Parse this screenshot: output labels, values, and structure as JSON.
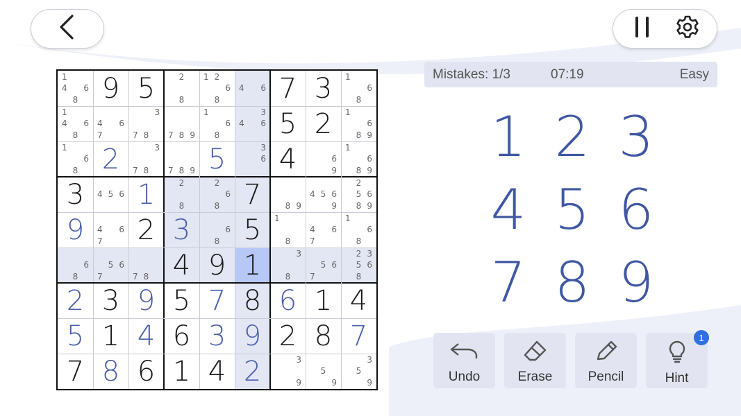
{
  "status": {
    "mistakes": "Mistakes: 1/3",
    "timer": "07:19",
    "difficulty": "Easy"
  },
  "number_pad": [
    "1",
    "2",
    "3",
    "4",
    "5",
    "6",
    "7",
    "8",
    "9"
  ],
  "tools": {
    "undo": "Undo",
    "erase": "Erase",
    "pencil": "Pencil",
    "hint": "Hint",
    "hint_count": "1"
  },
  "colors": {
    "accent": "#4058a3",
    "highlight": "#e3e6f3",
    "selected": "#b7c8f7"
  },
  "selected_cell": {
    "row": 5,
    "col": 5
  },
  "grid": [
    [
      {
        "n": [
          1,
          4,
          6,
          8
        ]
      },
      {
        "v": "9",
        "t": "g"
      },
      {
        "v": "5",
        "t": "g"
      },
      {
        "n": [
          2,
          8
        ]
      },
      {
        "n": [
          1,
          2,
          6,
          8
        ]
      },
      {
        "n": [
          4,
          6
        ]
      },
      {
        "v": "7",
        "t": "g"
      },
      {
        "v": "3",
        "t": "g"
      },
      {
        "n": [
          1,
          6,
          8
        ]
      }
    ],
    [
      {
        "n": [
          1,
          4,
          6,
          8
        ]
      },
      {
        "n": [
          4,
          6,
          7
        ]
      },
      {
        "n": [
          3,
          7,
          8
        ]
      },
      {
        "n": [
          7,
          8,
          9
        ]
      },
      {
        "n": [
          1,
          6,
          8
        ]
      },
      {
        "n": [
          3,
          4,
          6
        ]
      },
      {
        "v": "5",
        "t": "g"
      },
      {
        "v": "2",
        "t": "g"
      },
      {
        "n": [
          1,
          6,
          8,
          9
        ]
      }
    ],
    [
      {
        "n": [
          1,
          6,
          8
        ]
      },
      {
        "v": "2",
        "t": "u"
      },
      {
        "n": [
          3,
          7,
          8
        ]
      },
      {
        "n": [
          7,
          8,
          9
        ]
      },
      {
        "v": "5",
        "t": "u"
      },
      {
        "n": [
          3,
          6
        ]
      },
      {
        "v": "4",
        "t": "g"
      },
      {
        "n": [
          6,
          9
        ]
      },
      {
        "n": [
          1,
          6,
          8,
          9
        ]
      }
    ],
    [
      {
        "v": "3",
        "t": "g"
      },
      {
        "n": [
          4,
          5,
          6
        ]
      },
      {
        "v": "1",
        "t": "u"
      },
      {
        "n": [
          2,
          8
        ]
      },
      {
        "n": [
          2,
          6,
          8
        ]
      },
      {
        "v": "7",
        "t": "g"
      },
      {
        "n": [
          8,
          9
        ]
      },
      {
        "n": [
          4,
          5,
          6,
          9
        ]
      },
      {
        "n": [
          2,
          5,
          6,
          8,
          9
        ]
      }
    ],
    [
      {
        "v": "9",
        "t": "u"
      },
      {
        "n": [
          4,
          6,
          7
        ]
      },
      {
        "v": "2",
        "t": "g"
      },
      {
        "v": "3",
        "t": "u"
      },
      {
        "n": [
          6,
          8
        ]
      },
      {
        "v": "5",
        "t": "g"
      },
      {
        "n": [
          1,
          8
        ]
      },
      {
        "n": [
          4,
          6,
          7
        ]
      },
      {
        "n": [
          1,
          6,
          8
        ]
      }
    ],
    [
      {
        "n": [
          6,
          8
        ]
      },
      {
        "n": [
          5,
          6,
          7
        ]
      },
      {
        "n": [
          7,
          8
        ]
      },
      {
        "v": "4",
        "t": "g"
      },
      {
        "v": "9",
        "t": "g"
      },
      {
        "v": "1",
        "t": "g"
      },
      {
        "n": [
          3,
          8
        ]
      },
      {
        "n": [
          5,
          6,
          7
        ]
      },
      {
        "n": [
          2,
          3,
          5,
          6,
          8
        ]
      }
    ],
    [
      {
        "v": "2",
        "t": "u"
      },
      {
        "v": "3",
        "t": "g"
      },
      {
        "v": "9",
        "t": "u"
      },
      {
        "v": "5",
        "t": "g"
      },
      {
        "v": "7",
        "t": "u"
      },
      {
        "v": "8",
        "t": "g"
      },
      {
        "v": "6",
        "t": "u"
      },
      {
        "v": "1",
        "t": "g"
      },
      {
        "v": "4",
        "t": "g"
      }
    ],
    [
      {
        "v": "5",
        "t": "u"
      },
      {
        "v": "1",
        "t": "g"
      },
      {
        "v": "4",
        "t": "u"
      },
      {
        "v": "6",
        "t": "g"
      },
      {
        "v": "3",
        "t": "u"
      },
      {
        "v": "9",
        "t": "u"
      },
      {
        "v": "2",
        "t": "g"
      },
      {
        "v": "8",
        "t": "g"
      },
      {
        "v": "7",
        "t": "u"
      }
    ],
    [
      {
        "v": "7",
        "t": "g"
      },
      {
        "v": "8",
        "t": "u"
      },
      {
        "v": "6",
        "t": "g"
      },
      {
        "v": "1",
        "t": "g"
      },
      {
        "v": "4",
        "t": "g"
      },
      {
        "v": "2",
        "t": "u"
      },
      {
        "n": [
          3,
          9
        ]
      },
      {
        "n": [
          5,
          9
        ]
      },
      {
        "n": [
          3,
          5,
          9
        ]
      }
    ]
  ]
}
